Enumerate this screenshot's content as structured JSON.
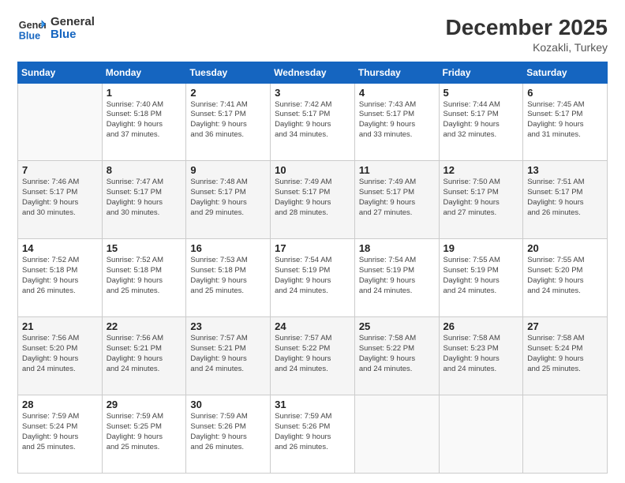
{
  "header": {
    "logo_general": "General",
    "logo_blue": "Blue",
    "month": "December 2025",
    "location": "Kozakli, Turkey"
  },
  "weekdays": [
    "Sunday",
    "Monday",
    "Tuesday",
    "Wednesday",
    "Thursday",
    "Friday",
    "Saturday"
  ],
  "weeks": [
    [
      {
        "day": "",
        "info": ""
      },
      {
        "day": "1",
        "info": "Sunrise: 7:40 AM\nSunset: 5:18 PM\nDaylight: 9 hours\nand 37 minutes."
      },
      {
        "day": "2",
        "info": "Sunrise: 7:41 AM\nSunset: 5:17 PM\nDaylight: 9 hours\nand 36 minutes."
      },
      {
        "day": "3",
        "info": "Sunrise: 7:42 AM\nSunset: 5:17 PM\nDaylight: 9 hours\nand 34 minutes."
      },
      {
        "day": "4",
        "info": "Sunrise: 7:43 AM\nSunset: 5:17 PM\nDaylight: 9 hours\nand 33 minutes."
      },
      {
        "day": "5",
        "info": "Sunrise: 7:44 AM\nSunset: 5:17 PM\nDaylight: 9 hours\nand 32 minutes."
      },
      {
        "day": "6",
        "info": "Sunrise: 7:45 AM\nSunset: 5:17 PM\nDaylight: 9 hours\nand 31 minutes."
      }
    ],
    [
      {
        "day": "7",
        "info": "Sunrise: 7:46 AM\nSunset: 5:17 PM\nDaylight: 9 hours\nand 30 minutes."
      },
      {
        "day": "8",
        "info": "Sunrise: 7:47 AM\nSunset: 5:17 PM\nDaylight: 9 hours\nand 30 minutes."
      },
      {
        "day": "9",
        "info": "Sunrise: 7:48 AM\nSunset: 5:17 PM\nDaylight: 9 hours\nand 29 minutes."
      },
      {
        "day": "10",
        "info": "Sunrise: 7:49 AM\nSunset: 5:17 PM\nDaylight: 9 hours\nand 28 minutes."
      },
      {
        "day": "11",
        "info": "Sunrise: 7:49 AM\nSunset: 5:17 PM\nDaylight: 9 hours\nand 27 minutes."
      },
      {
        "day": "12",
        "info": "Sunrise: 7:50 AM\nSunset: 5:17 PM\nDaylight: 9 hours\nand 27 minutes."
      },
      {
        "day": "13",
        "info": "Sunrise: 7:51 AM\nSunset: 5:17 PM\nDaylight: 9 hours\nand 26 minutes."
      }
    ],
    [
      {
        "day": "14",
        "info": "Sunrise: 7:52 AM\nSunset: 5:18 PM\nDaylight: 9 hours\nand 26 minutes."
      },
      {
        "day": "15",
        "info": "Sunrise: 7:52 AM\nSunset: 5:18 PM\nDaylight: 9 hours\nand 25 minutes."
      },
      {
        "day": "16",
        "info": "Sunrise: 7:53 AM\nSunset: 5:18 PM\nDaylight: 9 hours\nand 25 minutes."
      },
      {
        "day": "17",
        "info": "Sunrise: 7:54 AM\nSunset: 5:19 PM\nDaylight: 9 hours\nand 24 minutes."
      },
      {
        "day": "18",
        "info": "Sunrise: 7:54 AM\nSunset: 5:19 PM\nDaylight: 9 hours\nand 24 minutes."
      },
      {
        "day": "19",
        "info": "Sunrise: 7:55 AM\nSunset: 5:19 PM\nDaylight: 9 hours\nand 24 minutes."
      },
      {
        "day": "20",
        "info": "Sunrise: 7:55 AM\nSunset: 5:20 PM\nDaylight: 9 hours\nand 24 minutes."
      }
    ],
    [
      {
        "day": "21",
        "info": "Sunrise: 7:56 AM\nSunset: 5:20 PM\nDaylight: 9 hours\nand 24 minutes."
      },
      {
        "day": "22",
        "info": "Sunrise: 7:56 AM\nSunset: 5:21 PM\nDaylight: 9 hours\nand 24 minutes."
      },
      {
        "day": "23",
        "info": "Sunrise: 7:57 AM\nSunset: 5:21 PM\nDaylight: 9 hours\nand 24 minutes."
      },
      {
        "day": "24",
        "info": "Sunrise: 7:57 AM\nSunset: 5:22 PM\nDaylight: 9 hours\nand 24 minutes."
      },
      {
        "day": "25",
        "info": "Sunrise: 7:58 AM\nSunset: 5:22 PM\nDaylight: 9 hours\nand 24 minutes."
      },
      {
        "day": "26",
        "info": "Sunrise: 7:58 AM\nSunset: 5:23 PM\nDaylight: 9 hours\nand 24 minutes."
      },
      {
        "day": "27",
        "info": "Sunrise: 7:58 AM\nSunset: 5:24 PM\nDaylight: 9 hours\nand 25 minutes."
      }
    ],
    [
      {
        "day": "28",
        "info": "Sunrise: 7:59 AM\nSunset: 5:24 PM\nDaylight: 9 hours\nand 25 minutes."
      },
      {
        "day": "29",
        "info": "Sunrise: 7:59 AM\nSunset: 5:25 PM\nDaylight: 9 hours\nand 25 minutes."
      },
      {
        "day": "30",
        "info": "Sunrise: 7:59 AM\nSunset: 5:26 PM\nDaylight: 9 hours\nand 26 minutes."
      },
      {
        "day": "31",
        "info": "Sunrise: 7:59 AM\nSunset: 5:26 PM\nDaylight: 9 hours\nand 26 minutes."
      },
      {
        "day": "",
        "info": ""
      },
      {
        "day": "",
        "info": ""
      },
      {
        "day": "",
        "info": ""
      }
    ]
  ]
}
